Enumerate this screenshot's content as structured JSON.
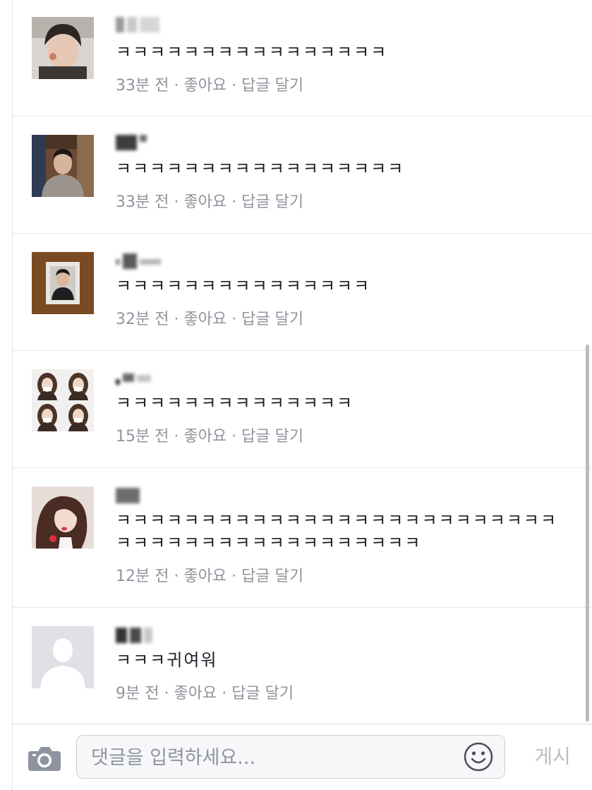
{
  "comments": [
    {
      "text": "ㅋㅋㅋㅋㅋㅋㅋㅋㅋㅋㅋㅋㅋㅋㅋㅋ",
      "time": "33분 전",
      "like": "좋아요",
      "reply": "답글 달기",
      "sep": " · "
    },
    {
      "text": "ㅋㅋㅋㅋㅋㅋㅋㅋㅋㅋㅋㅋㅋㅋㅋㅋㅋ",
      "time": "33분 전",
      "like": "좋아요",
      "reply": "답글 달기",
      "sep": " · "
    },
    {
      "text": "ㅋㅋㅋㅋㅋㅋㅋㅋㅋㅋㅋㅋㅋㅋㅋ",
      "time": "32분 전",
      "like": "좋아요",
      "reply": "답글 달기",
      "sep": " · "
    },
    {
      "text": "ㅋㅋㅋㅋㅋㅋㅋㅋㅋㅋㅋㅋㅋㅋ",
      "time": "15분 전",
      "like": "좋아요",
      "reply": "답글 달기",
      "sep": " · "
    },
    {
      "text": "ㅋㅋㅋㅋㅋㅋㅋㅋㅋㅋㅋㅋㅋㅋㅋㅋㅋㅋㅋㅋㅋㅋㅋㅋㅋㅋㅋㅋㅋㅋㅋㅋㅋㅋㅋㅋㅋㅋㅋㅋㅋㅋㅋㅋ",
      "time": "12분 전",
      "like": "좋아요",
      "reply": "답글 달기",
      "sep": " · "
    },
    {
      "text": "ㅋㅋㅋ귀여워",
      "time": "9분 전",
      "like": "좋아요",
      "reply": "답글 달기",
      "sep": " · "
    }
  ],
  "composer": {
    "placeholder": "댓글을 입력하세요...",
    "post_label": "게시",
    "camera_icon": "camera-icon",
    "emoji_icon": "smiley-icon"
  },
  "colors": {
    "meta_text": "#90949c",
    "body_text": "#1d2129",
    "divider": "#e6e7eb",
    "post_disabled": "#bcc0c4"
  }
}
